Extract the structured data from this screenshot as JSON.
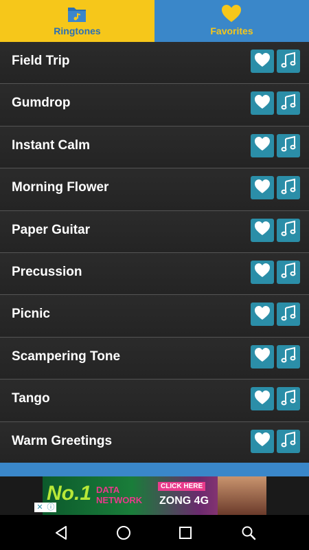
{
  "tabs": [
    {
      "label": "Ringtones",
      "icon": "music-folder-icon",
      "active": true
    },
    {
      "label": "Favorites",
      "icon": "heart-icon",
      "active": false
    }
  ],
  "ringtones": [
    {
      "title": "Field Trip"
    },
    {
      "title": "Gumdrop"
    },
    {
      "title": "Instant Calm"
    },
    {
      "title": "Morning Flower"
    },
    {
      "title": "Paper Guitar"
    },
    {
      "title": "Precussion"
    },
    {
      "title": "Picnic"
    },
    {
      "title": "Scampering Tone"
    },
    {
      "title": "Tango"
    },
    {
      "title": "Warm Greetings"
    }
  ],
  "ad": {
    "headline": "No.1",
    "subline": "DATA NETWORK",
    "cta": "CLICK HERE",
    "brand": "ZONG 4G"
  },
  "colors": {
    "tab_active": "#f6c71a",
    "tab_inactive": "#3a87c9",
    "button": "#2b8ea8",
    "row_bg": "#2b2b2b"
  },
  "navbar": {
    "icons": [
      "back-icon",
      "home-icon",
      "recents-icon",
      "search-icon"
    ]
  }
}
